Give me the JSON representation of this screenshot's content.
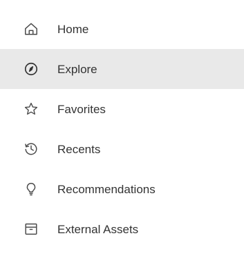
{
  "sidebar": {
    "items": [
      {
        "label": "Home",
        "icon": "home-icon",
        "active": false
      },
      {
        "label": "Explore",
        "icon": "compass-icon",
        "active": true
      },
      {
        "label": "Favorites",
        "icon": "star-icon",
        "active": false
      },
      {
        "label": "Recents",
        "icon": "history-icon",
        "active": false
      },
      {
        "label": "Recommendations",
        "icon": "lightbulb-icon",
        "active": false
      },
      {
        "label": "External Assets",
        "icon": "archive-box-icon",
        "active": false
      }
    ]
  },
  "colors": {
    "text": "#333333",
    "icon": "#4a4a4a",
    "active_background": "#e9e9e9",
    "background": "#ffffff"
  }
}
